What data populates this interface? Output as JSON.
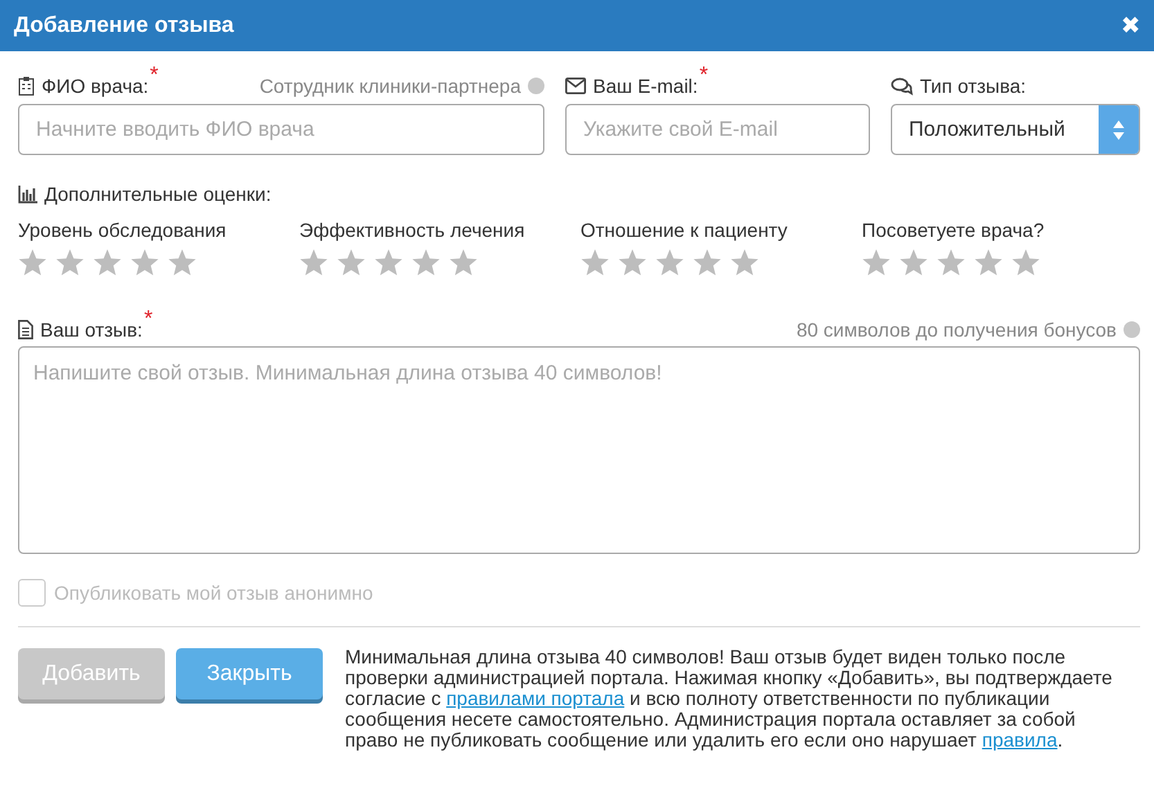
{
  "window": {
    "title": "Добавление отзыва",
    "close": "✖"
  },
  "fields": [
    {
      "kind": "text",
      "label": "ФИО врача:",
      "required_mark": "*",
      "hint": "Сотрудник клиники-партнера",
      "placeholder": "Начните вводить ФИО врача"
    },
    {
      "kind": "email",
      "label": "Ваш E-mail:",
      "required_mark": "*",
      "placeholder": "Укажите свой E-mail"
    },
    {
      "kind": "select",
      "label": "Тип отзыва:",
      "value": "Положительный"
    }
  ],
  "ratings": {
    "title": "Дополнительные оценки:",
    "items": [
      {
        "label": "Уровень обследования",
        "stars": 0
      },
      {
        "label": "Эффективность лечения",
        "stars": 0
      },
      {
        "label": "Отношение к пациенту",
        "stars": 0
      },
      {
        "label": "Посоветуете врача?",
        "stars": 0
      }
    ]
  },
  "review": {
    "label": "Ваш отзыв:",
    "required_mark": "*",
    "hint": "80 символов до получения бонусов",
    "placeholder": "Напишите свой отзыв. Минимальная длина отзыва 40 символов!"
  },
  "anonymous": {
    "label": "Опубликовать мой отзыв анонимно",
    "checked": false,
    "disabled": true
  },
  "buttons": [
    {
      "label": "Добавить",
      "kind": "submit",
      "disabled": true
    },
    {
      "label": "Закрыть",
      "kind": "close",
      "disabled": false
    }
  ],
  "note": [
    {
      "kind": "text",
      "text": "Минимальная длина отзыва 40 символов! Ваш отзыв будет виден только после проверки администрацией портала. Нажимая кнопку «Добавить», вы подтверждаете согласие с "
    },
    {
      "kind": "link",
      "text": "правилами портала"
    },
    {
      "kind": "text",
      "text": " и всю полноту ответственности по публикации сообщения несете самостоятельно. Администрация портала оставляет за собой право не публиковать сообщение или удалить его если оно нарушает "
    },
    {
      "kind": "link",
      "text": "правила"
    },
    {
      "kind": "text",
      "text": "."
    }
  ]
}
